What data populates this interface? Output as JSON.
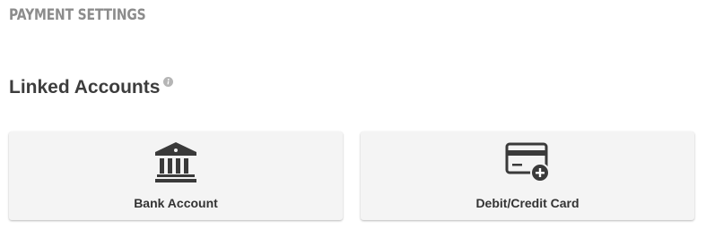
{
  "page": {
    "title": "PAYMENT SETTINGS"
  },
  "linked_accounts": {
    "title": "Linked Accounts",
    "info_icon": "info-icon",
    "options": [
      {
        "label": "Bank Account",
        "icon": "bank-icon"
      },
      {
        "label": "Debit/Credit Card",
        "icon": "credit-card-add-icon"
      }
    ]
  },
  "colors": {
    "page_title": "#8c8c8c",
    "heading": "#3d3d3d",
    "card_bg": "#f4f4f4",
    "icon": "#3a3a3a"
  }
}
